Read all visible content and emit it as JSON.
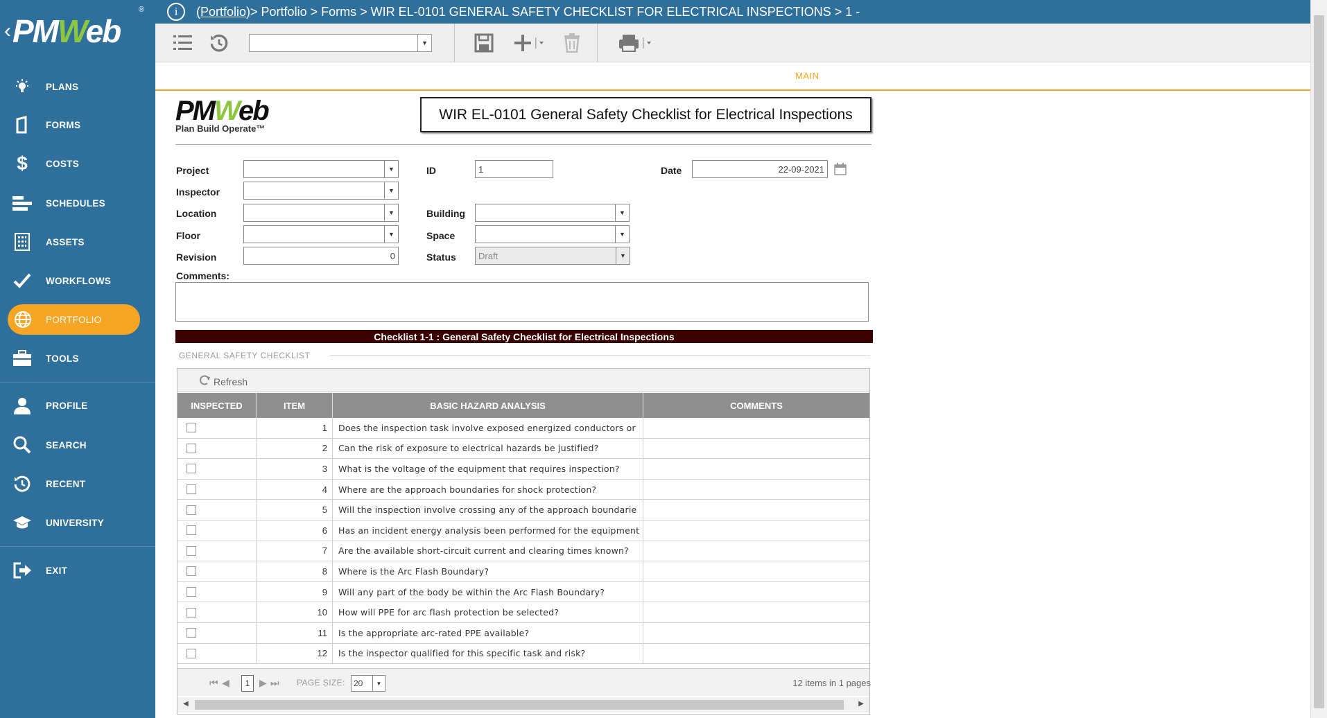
{
  "app": {
    "logo_text": "PMWeb"
  },
  "nav": {
    "items": [
      {
        "label": "PLANS",
        "icon": "lightbulb-icon"
      },
      {
        "label": "FORMS",
        "icon": "document-icon"
      },
      {
        "label": "COSTS",
        "icon": "dollar-icon"
      },
      {
        "label": "SCHEDULES",
        "icon": "schedule-bars-icon"
      },
      {
        "label": "ASSETS",
        "icon": "building-icon"
      },
      {
        "label": "WORKFLOWS",
        "icon": "checkmark-icon"
      },
      {
        "label": "PORTFOLIO",
        "icon": "globe-icon",
        "active": true
      },
      {
        "label": "TOOLS",
        "icon": "toolbox-icon"
      },
      {
        "label": "PROFILE",
        "icon": "user-icon"
      },
      {
        "label": "SEARCH",
        "icon": "search-icon"
      },
      {
        "label": "RECENT",
        "icon": "history-icon"
      },
      {
        "label": "UNIVERSITY",
        "icon": "graduation-cap-icon"
      },
      {
        "label": "EXIT",
        "icon": "exit-icon"
      }
    ]
  },
  "breadcrumb": {
    "link": "(Portfolio)",
    "rest": " > Portfolio > Forms > WIR EL-0101 GENERAL SAFETY CHECKLIST FOR ELECTRICAL INSPECTIONS > 1 -"
  },
  "toolbar": {
    "select_value": ""
  },
  "tabs": {
    "main": "MAIN"
  },
  "form": {
    "logo_text": "PMWeb",
    "logo_tagline": "Plan Build Operate™",
    "title": "WIR EL-0101 General Safety Checklist for Electrical Inspections",
    "labels": {
      "project": "Project",
      "inspector": "Inspector",
      "location": "Location",
      "floor": "Floor",
      "revision": "Revision",
      "id": "ID",
      "building": "Building",
      "space": "Space",
      "status": "Status",
      "date": "Date",
      "comments": "Comments:"
    },
    "values": {
      "project": "",
      "inspector": "",
      "location": "",
      "floor": "",
      "revision": "0",
      "id": "1",
      "building": "",
      "space": "",
      "status": "Draft",
      "date": "22-09-2021"
    }
  },
  "checklist": {
    "bar_title": "Checklist 1-1 : General Safety Checklist for Electrical Inspections",
    "section_title": "GENERAL SAFETY CHECKLIST",
    "refresh_label": "Refresh",
    "columns": [
      "INSPECTED",
      "ITEM",
      "BASIC HAZARD ANALYSIS",
      "COMMENTS"
    ],
    "rows": [
      {
        "item": "1",
        "text": "Does the inspection task involve exposed energized conductors or",
        "comments": ""
      },
      {
        "item": "2",
        "text": "Can the risk of exposure to electrical hazards be justified?",
        "comments": ""
      },
      {
        "item": "3",
        "text": "What is the voltage of the equipment that requires inspection?",
        "comments": ""
      },
      {
        "item": "4",
        "text": "Where are the approach boundaries for shock protection?",
        "comments": ""
      },
      {
        "item": "5",
        "text": "Will the inspection involve crossing any of the approach boundarie",
        "comments": ""
      },
      {
        "item": "6",
        "text": "Has an incident energy analysis been performed for the equipment",
        "comments": ""
      },
      {
        "item": "7",
        "text": "Are the available short-circuit current and clearing times known?",
        "comments": ""
      },
      {
        "item": "8",
        "text": "Where is the Arc Flash Boundary?",
        "comments": ""
      },
      {
        "item": "9",
        "text": "Will any part of the body be within the Arc Flash Boundary?",
        "comments": ""
      },
      {
        "item": "10",
        "text": "How will PPE for arc flash protection be selected?",
        "comments": ""
      },
      {
        "item": "11",
        "text": "Is the appropriate arc-rated PPE available?",
        "comments": ""
      },
      {
        "item": "12",
        "text": "Is the inspector qualified for this specific task and risk?",
        "comments": ""
      }
    ],
    "pager": {
      "page": "1",
      "page_size_label": "PAGE SIZE:",
      "page_size": "20",
      "summary": "12 items in 1 pages"
    }
  }
}
